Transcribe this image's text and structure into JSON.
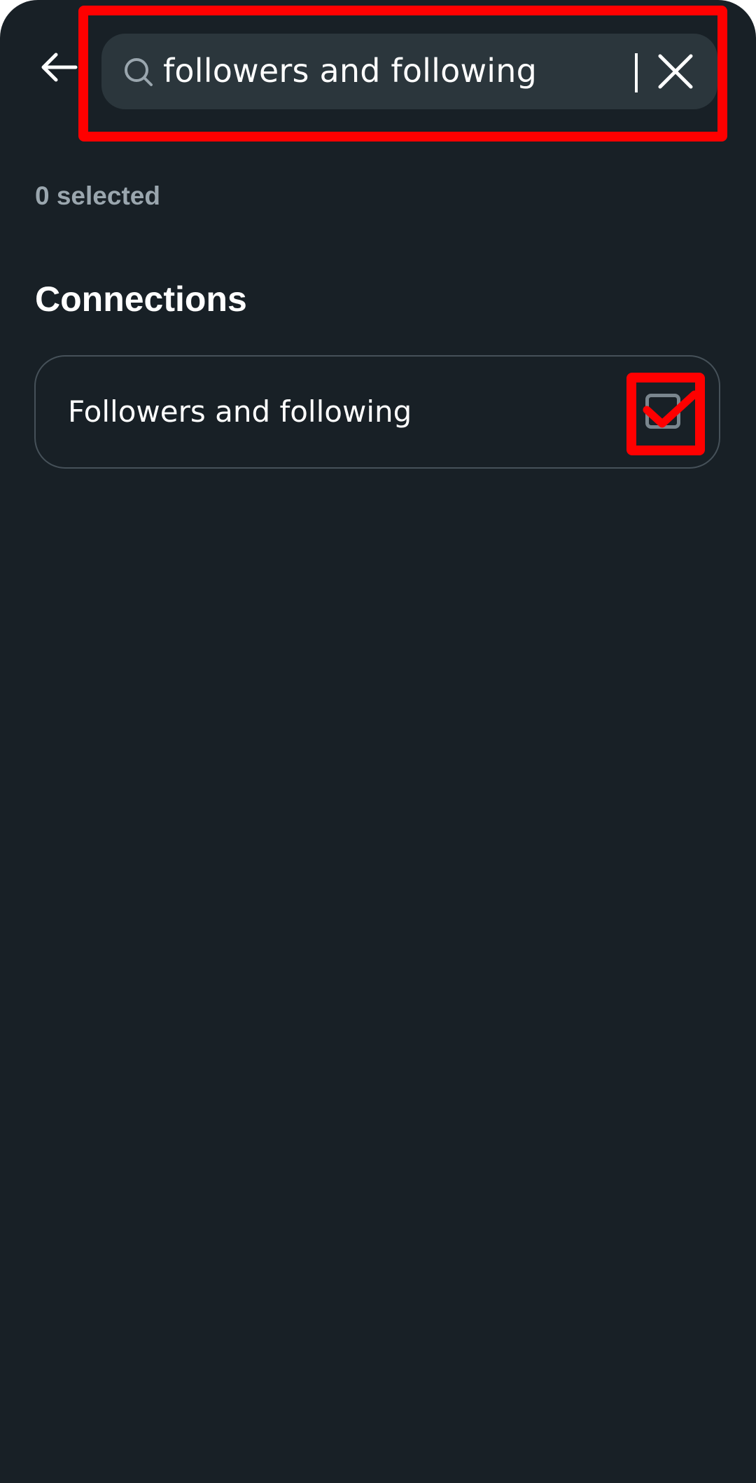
{
  "header": {
    "back_icon": "arrow-left-icon",
    "search": {
      "icon": "search-icon",
      "value": "followers and following",
      "clear_icon": "close-icon"
    }
  },
  "selection": {
    "count_text": "0 selected"
  },
  "sections": [
    {
      "title": "Connections",
      "options": [
        {
          "label": "Followers and following",
          "checked": false,
          "checkbox_icon": "checkbox-icon"
        }
      ]
    }
  ],
  "colors": {
    "background": "#182026",
    "search_bar": "#2b363c",
    "card_border": "#465159",
    "muted_text": "#9aa6ae",
    "annotation": "#ff0000"
  }
}
